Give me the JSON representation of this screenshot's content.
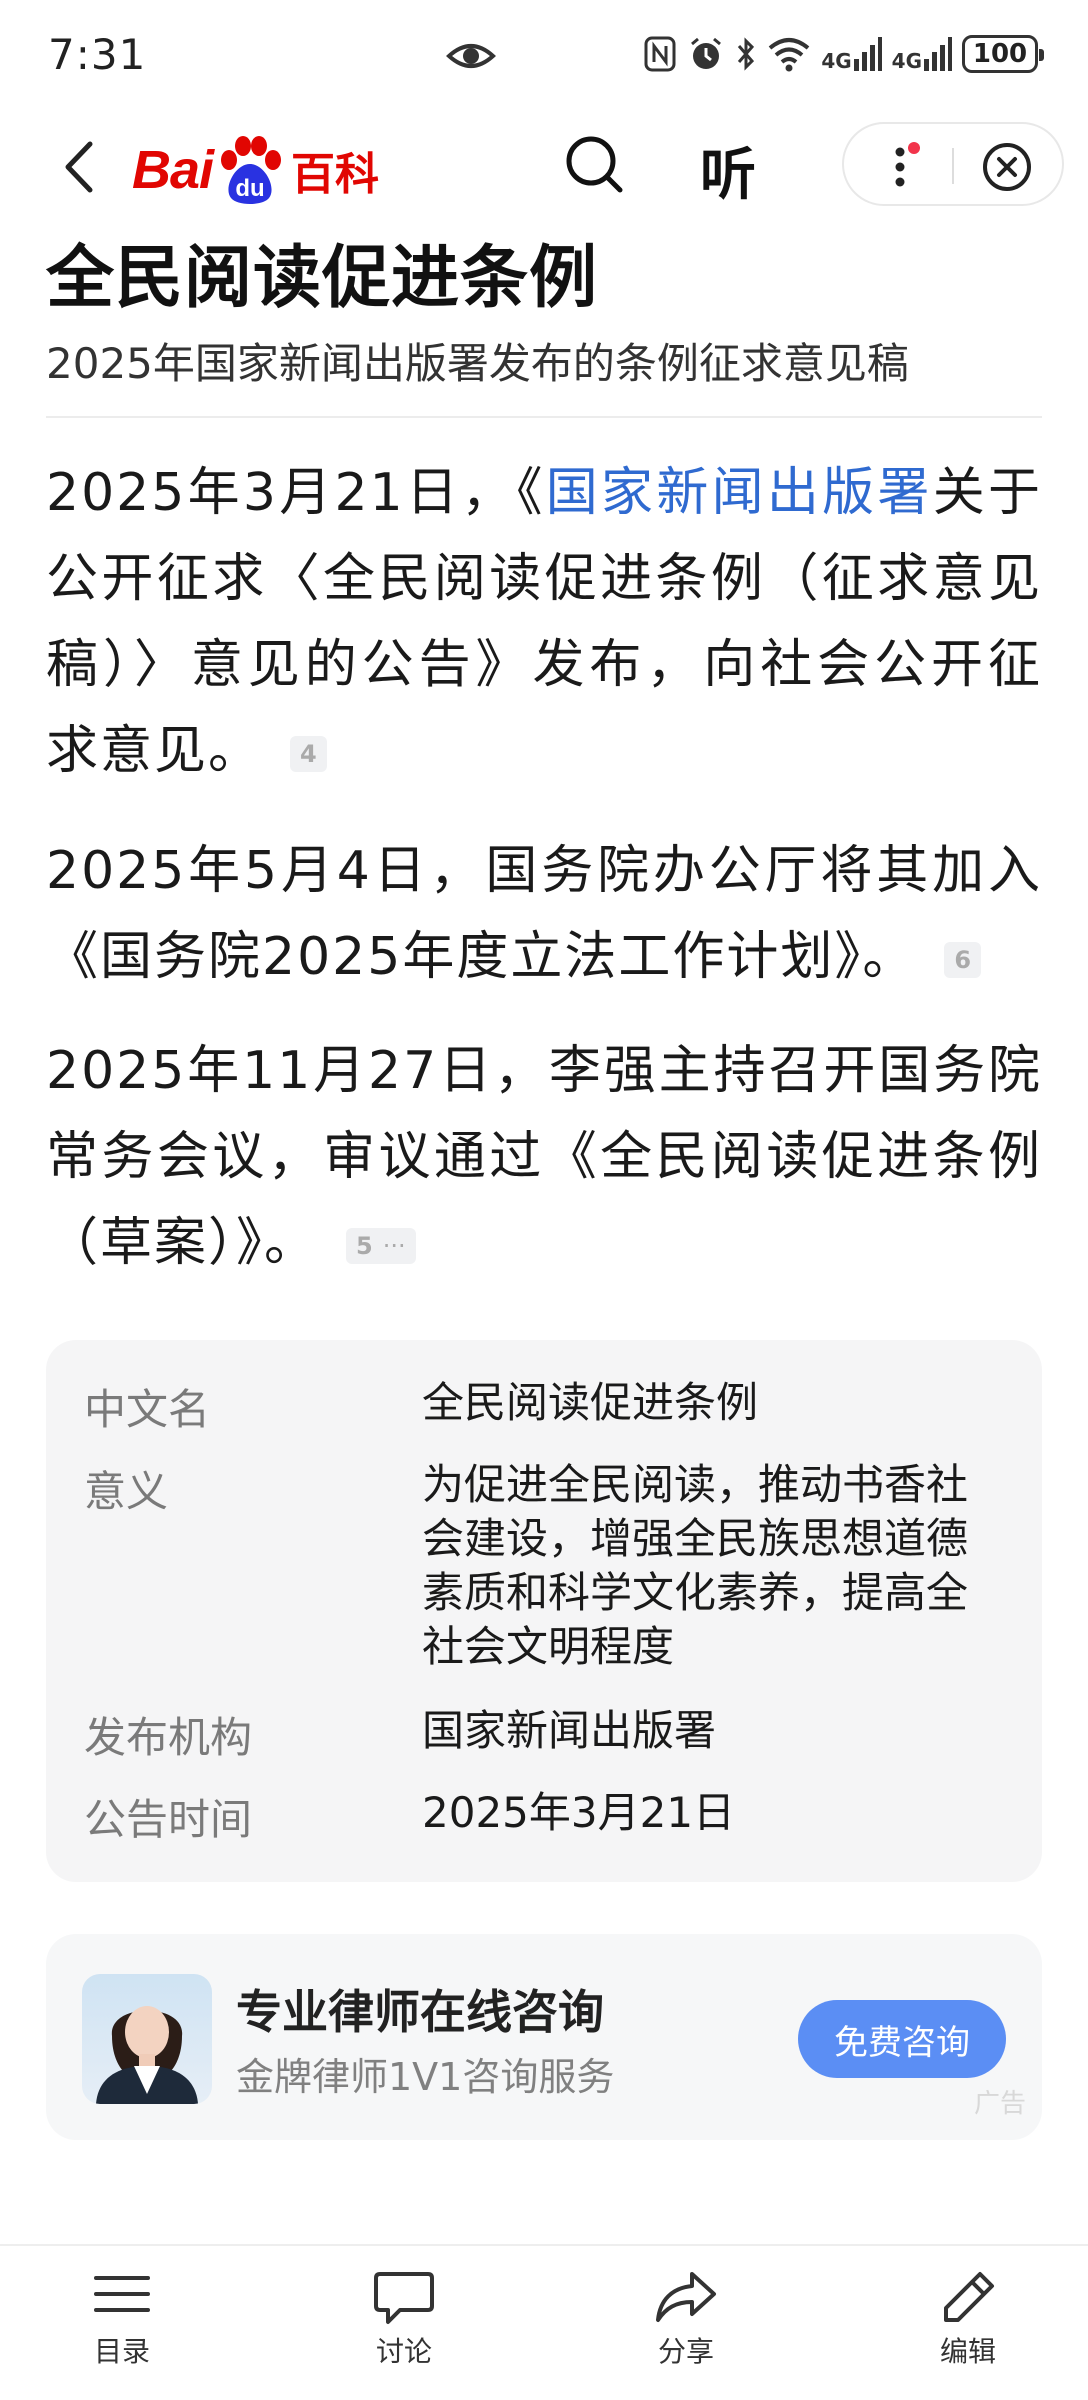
{
  "status_bar": {
    "time": "7:31",
    "network_1": "4G",
    "network_2": "4G",
    "battery": "100"
  },
  "nav": {
    "logo_text": "Bai",
    "logo_text_2": "du",
    "logo_suffix": "百科",
    "listen_label": "听"
  },
  "article": {
    "title": "全民阅读促进条例",
    "subtitle": "2025年国家新闻出版署发布的条例征求意见稿",
    "paragraphs": [
      {
        "before_link": "2025年3月21日，《",
        "link": "国家新闻出版署",
        "after_link": "关于公开征求〈全民阅读促进条例（征求意见稿）〉意见的公告》发布，向社会公开征求意见。",
        "ref": "4"
      },
      {
        "text": "2025年5月4日，国务院办公厅将其加入《国务院2025年度立法工作计划》。",
        "ref": "6"
      },
      {
        "text": "2025年11月27日，李强主持召开国务院常务会议，审议通过《全民阅读促进条例（草案）》。",
        "ref": "5",
        "ref_more": "···"
      }
    ]
  },
  "infobox": [
    {
      "key": "中文名",
      "value": "全民阅读促进条例"
    },
    {
      "key": "意义",
      "value": "为促进全民阅读，推动书香社会建设，增强全民族思想道德素质和科学文化素养，提高全社会文明程度"
    },
    {
      "key": "发布机构",
      "value": "国家新闻出版署"
    },
    {
      "key": "公告时间",
      "value": "2025年3月21日"
    }
  ],
  "ad": {
    "title": "专业律师在线咨询",
    "subtitle": "金牌律师1V1咨询服务",
    "button": "免费咨询",
    "tag": "广告"
  },
  "bottom_tabs": [
    {
      "label": "目录",
      "icon": "list-icon"
    },
    {
      "label": "讨论",
      "icon": "chat-icon"
    },
    {
      "label": "分享",
      "icon": "share-icon"
    },
    {
      "label": "编辑",
      "icon": "edit-icon"
    }
  ],
  "colors": {
    "brand_red": "#e10602",
    "brand_blue": "#2932e1",
    "link_blue": "#2f6ad0",
    "button_blue": "#5b8ef4"
  }
}
